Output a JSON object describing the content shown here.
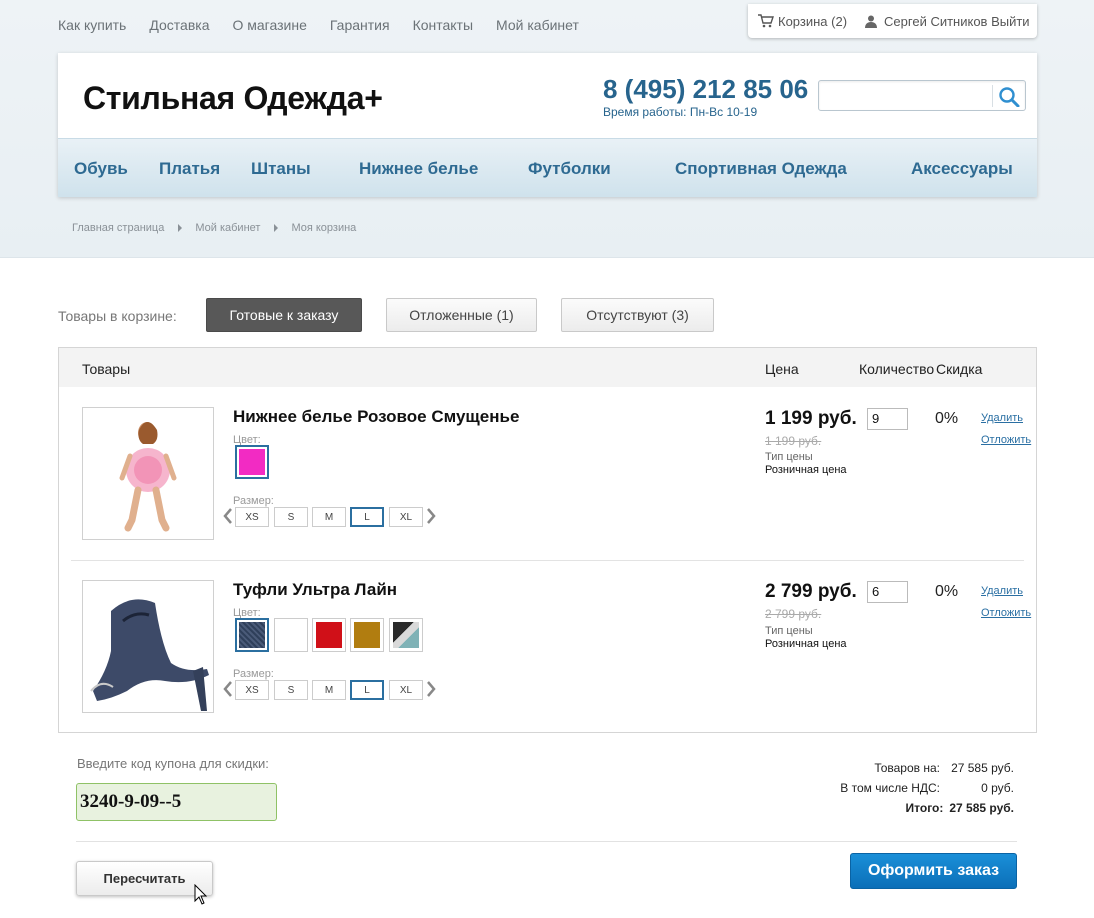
{
  "topnav": [
    "Как купить",
    "Доставка",
    "О магазине",
    "Гарантия",
    "Контакты",
    "Мой кабинет"
  ],
  "userbox": {
    "cart_label": "Корзина (2)",
    "user_label": "Сергей Ситников Выйти"
  },
  "header": {
    "logo": "Стильная Одежда+",
    "phone": "8 (495) 212 85 06",
    "worktime": "Время работы: Пн-Вс 10-19",
    "search_placeholder": ""
  },
  "categories": [
    "Обувь",
    "Платья",
    "Штаны",
    "Нижнее белье",
    "Футболки",
    "Спортивная Одежда",
    "Аксессуары"
  ],
  "breadcrumb": [
    "Главная страница",
    "Мой кабинет",
    "Моя корзина"
  ],
  "tabs": {
    "label": "Товары в корзине:",
    "items": [
      "Готовые к заказу",
      "Отложенные (1)",
      "Отсутствуют (3)"
    ],
    "active": 0
  },
  "table_head": {
    "products": "Товары",
    "price": "Цена",
    "qty": "Количество",
    "discount": "Скидка"
  },
  "items": [
    {
      "name": "Нижнее белье Розовое Смущенье",
      "color_label": "Цвет:",
      "colors": [
        "#f22bc3"
      ],
      "selected_color": 0,
      "size_label": "Размер:",
      "sizes": [
        "XS",
        "S",
        "M",
        "L",
        "XL"
      ],
      "selected_size": 3,
      "price": "1 199 руб.",
      "old_price": "1 199 руб.",
      "price_type_label": "Тип цены",
      "price_type": "Розничная цена",
      "qty": "9",
      "discount": "0%",
      "delete": "Удалить",
      "postpone": "Отложить"
    },
    {
      "name": "Туфли Ультра Лайн",
      "color_label": "Цвет:",
      "colors": [
        "#2f3f5a",
        "#ffffff",
        "#d01018",
        "#b17d10",
        "#7a8a90"
      ],
      "selected_color": 0,
      "size_label": "Размер:",
      "sizes": [
        "XS",
        "S",
        "M",
        "L",
        "XL"
      ],
      "selected_size": 3,
      "price": "2 799 руб.",
      "old_price": "2 799 руб.",
      "price_type_label": "Тип цены",
      "price_type": "Розничная цена",
      "qty": "6",
      "discount": "0%",
      "delete": "Удалить",
      "postpone": "Отложить"
    }
  ],
  "coupon": {
    "label": "Введите код купона для скидки:",
    "value": "3240-9-09--5"
  },
  "totals": {
    "goods_label": "Товаров на:",
    "goods_value": "27 585 руб.",
    "vat_label": "В том числе НДС:",
    "vat_value": "0 руб.",
    "total_label": "Итого:",
    "total_value": "27 585 руб."
  },
  "buttons": {
    "recalc": "Пересчитать",
    "order": "Оформить заказ"
  },
  "colors": {
    "accent": "#27648d",
    "order_button": "#0b7ac6",
    "coupon_border": "#8fc266"
  }
}
